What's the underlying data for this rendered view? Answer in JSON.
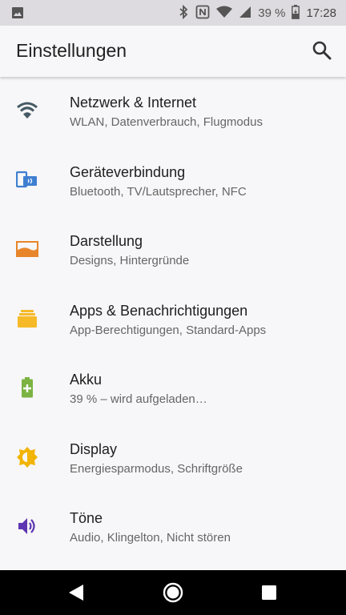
{
  "status": {
    "battery": "39 %",
    "time": "17:28"
  },
  "header": {
    "title": "Einstellungen"
  },
  "items": [
    {
      "label": "Netzwerk & Internet",
      "sub": "WLAN, Datenverbrauch, Flugmodus",
      "icon": "wifi-icon",
      "color": "#455a64"
    },
    {
      "label": "Geräteverbindung",
      "sub": "Bluetooth, TV/Lautsprecher, NFC",
      "icon": "devices-icon",
      "color": "#3f7fd1"
    },
    {
      "label": "Darstellung",
      "sub": "Designs, Hintergründe",
      "icon": "wallpaper-icon",
      "color": "#e8852a"
    },
    {
      "label": "Apps & Benachrichtigungen",
      "sub": "App-Berechtigungen, Standard-Apps",
      "icon": "apps-icon",
      "color": "#f6b927"
    },
    {
      "label": "Akku",
      "sub": "39 % – wird aufgeladen…",
      "icon": "battery-charging-icon",
      "color": "#7cb342"
    },
    {
      "label": "Display",
      "sub": "Energiesparmodus, Schriftgröße",
      "icon": "brightness-icon",
      "color": "#f2b400"
    },
    {
      "label": "Töne",
      "sub": "Audio, Klingelton, Nicht stören",
      "icon": "volume-icon",
      "color": "#5e35b1"
    }
  ]
}
